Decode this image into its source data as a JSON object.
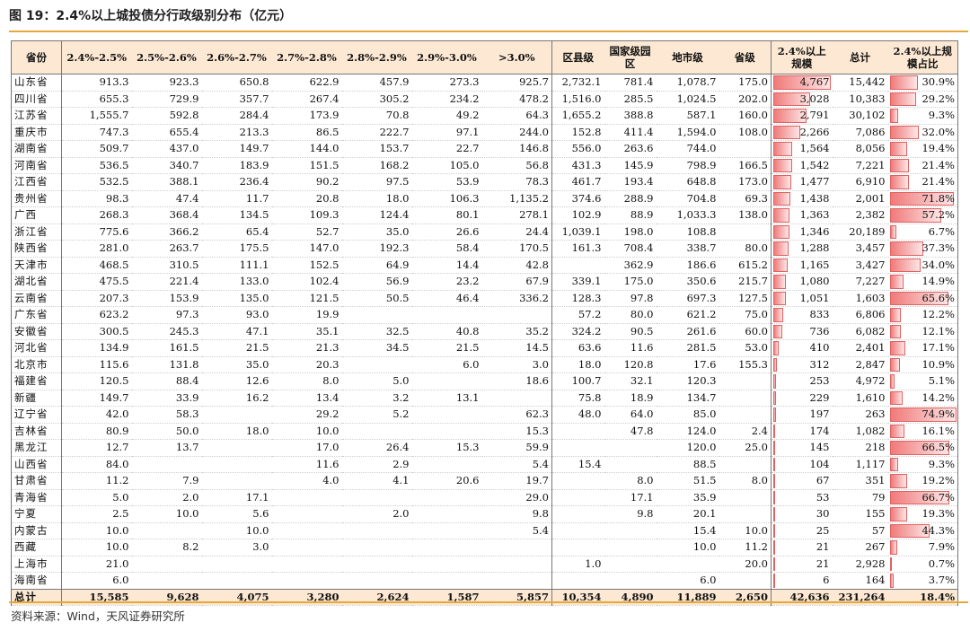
{
  "figure": {
    "title": "图 19：2.4%以上城投债分行政级别分布（亿元）",
    "source": "资料来源：Wind，天风证券研究所"
  },
  "headers": [
    "省份",
    "2.4%-2.5%",
    "2.5%-2.6%",
    "2.6%-2.7%",
    "2.7%-2.8%",
    "2.8%-2.9%",
    "2.9%-3.0%",
    ">3.0%",
    "区县级",
    "国家级园区",
    "地市级",
    "省级",
    "2.4%以上规模",
    "总计",
    "2.4%以上规模占比"
  ],
  "rows": [
    [
      "山东省",
      "913.3",
      "923.3",
      "650.8",
      "622.9",
      "457.9",
      "273.3",
      "925.7",
      "2,732.1",
      "781.4",
      "1,078.7",
      "175.0",
      "4,767",
      "15,442",
      "30.9%"
    ],
    [
      "四川省",
      "655.3",
      "729.9",
      "357.7",
      "267.4",
      "305.2",
      "234.2",
      "478.2",
      "1,516.0",
      "285.5",
      "1,024.5",
      "202.0",
      "3,028",
      "10,383",
      "29.2%"
    ],
    [
      "江苏省",
      "1,555.7",
      "592.8",
      "284.4",
      "173.9",
      "70.8",
      "49.2",
      "64.3",
      "1,655.2",
      "388.8",
      "587.1",
      "160.0",
      "2,791",
      "30,102",
      "9.3%"
    ],
    [
      "重庆市",
      "747.3",
      "655.4",
      "213.3",
      "86.5",
      "222.7",
      "97.1",
      "244.0",
      "152.8",
      "411.4",
      "1,594.0",
      "108.0",
      "2,266",
      "7,086",
      "32.0%"
    ],
    [
      "湖南省",
      "509.7",
      "437.0",
      "149.7",
      "144.0",
      "153.7",
      "22.7",
      "146.8",
      "556.0",
      "263.6",
      "744.0",
      "",
      "1,564",
      "8,056",
      "19.4%"
    ],
    [
      "河南省",
      "536.5",
      "340.7",
      "183.9",
      "151.5",
      "168.2",
      "105.0",
      "56.8",
      "431.3",
      "145.9",
      "798.9",
      "166.5",
      "1,542",
      "7,221",
      "21.4%"
    ],
    [
      "江西省",
      "532.5",
      "388.1",
      "236.4",
      "90.2",
      "97.5",
      "53.9",
      "78.3",
      "461.7",
      "193.4",
      "648.8",
      "173.0",
      "1,477",
      "6,910",
      "21.4%"
    ],
    [
      "贵州省",
      "98.3",
      "47.4",
      "11.7",
      "20.8",
      "18.0",
      "106.3",
      "1,135.2",
      "374.6",
      "288.9",
      "704.8",
      "69.3",
      "1,438",
      "2,001",
      "71.8%"
    ],
    [
      "广西",
      "268.3",
      "368.4",
      "134.5",
      "109.3",
      "124.4",
      "80.1",
      "278.1",
      "102.9",
      "88.9",
      "1,033.3",
      "138.0",
      "1,363",
      "2,382",
      "57.2%"
    ],
    [
      "浙江省",
      "775.6",
      "366.2",
      "65.4",
      "52.7",
      "35.0",
      "26.6",
      "24.4",
      "1,039.1",
      "198.0",
      "108.8",
      "",
      "1,346",
      "20,189",
      "6.7%"
    ],
    [
      "陕西省",
      "281.0",
      "263.7",
      "175.5",
      "147.0",
      "192.3",
      "58.4",
      "170.5",
      "161.3",
      "708.4",
      "338.7",
      "80.0",
      "1,288",
      "3,457",
      "37.3%"
    ],
    [
      "天津市",
      "468.5",
      "310.5",
      "111.1",
      "152.5",
      "64.9",
      "14.4",
      "42.8",
      "",
      "362.9",
      "186.6",
      "615.2",
      "1,165",
      "3,427",
      "34.0%"
    ],
    [
      "湖北省",
      "475.5",
      "221.4",
      "133.0",
      "102.4",
      "56.9",
      "23.2",
      "67.9",
      "339.1",
      "175.0",
      "350.6",
      "215.7",
      "1,080",
      "7,227",
      "14.9%"
    ],
    [
      "云南省",
      "207.3",
      "153.9",
      "135.0",
      "121.5",
      "50.5",
      "46.4",
      "336.2",
      "128.3",
      "97.8",
      "697.3",
      "127.5",
      "1,051",
      "1,603",
      "65.6%"
    ],
    [
      "广东省",
      "623.2",
      "97.3",
      "93.0",
      "19.9",
      "",
      "",
      "",
      "57.2",
      "80.0",
      "621.2",
      "75.0",
      "833",
      "6,806",
      "12.2%"
    ],
    [
      "安徽省",
      "300.5",
      "245.3",
      "47.1",
      "35.1",
      "32.5",
      "40.8",
      "35.2",
      "324.2",
      "90.5",
      "261.6",
      "60.0",
      "736",
      "6,082",
      "12.1%"
    ],
    [
      "河北省",
      "134.9",
      "161.5",
      "21.5",
      "21.3",
      "34.5",
      "21.5",
      "14.5",
      "63.6",
      "11.6",
      "281.5",
      "53.0",
      "410",
      "2,401",
      "17.1%"
    ],
    [
      "北京市",
      "115.6",
      "131.8",
      "35.0",
      "20.3",
      "",
      "6.0",
      "3.0",
      "18.0",
      "120.8",
      "17.6",
      "155.3",
      "312",
      "2,847",
      "10.9%"
    ],
    [
      "福建省",
      "120.5",
      "88.4",
      "12.6",
      "8.0",
      "5.0",
      "",
      "18.6",
      "100.7",
      "32.1",
      "120.3",
      "",
      "253",
      "4,972",
      "5.1%"
    ],
    [
      "新疆",
      "149.7",
      "33.9",
      "16.2",
      "13.4",
      "3.2",
      "13.1",
      "",
      "75.8",
      "18.9",
      "134.7",
      "",
      "229",
      "1,610",
      "14.2%"
    ],
    [
      "辽宁省",
      "42.0",
      "58.3",
      "",
      "29.2",
      "5.2",
      "",
      "62.3",
      "48.0",
      "64.0",
      "85.0",
      "",
      "197",
      "263",
      "74.9%"
    ],
    [
      "吉林省",
      "80.9",
      "50.0",
      "18.0",
      "10.0",
      "",
      "",
      "15.3",
      "",
      "47.8",
      "124.0",
      "2.4",
      "174",
      "1,082",
      "16.1%"
    ],
    [
      "黑龙江",
      "12.7",
      "13.7",
      "",
      "17.0",
      "26.4",
      "15.3",
      "59.9",
      "",
      "",
      "120.0",
      "25.0",
      "145",
      "218",
      "66.5%"
    ],
    [
      "山西省",
      "84.0",
      "",
      "",
      "11.6",
      "2.9",
      "",
      "5.4",
      "15.4",
      "",
      "88.5",
      "",
      "104",
      "1,117",
      "9.3%"
    ],
    [
      "甘肃省",
      "11.2",
      "7.9",
      "",
      "4.0",
      "4.1",
      "20.6",
      "19.7",
      "",
      "8.0",
      "51.5",
      "8.0",
      "67",
      "351",
      "19.2%"
    ],
    [
      "青海省",
      "5.0",
      "2.0",
      "17.1",
      "",
      "",
      "",
      "29.0",
      "",
      "17.1",
      "35.9",
      "",
      "53",
      "79",
      "66.7%"
    ],
    [
      "宁夏",
      "2.5",
      "10.0",
      "5.6",
      "",
      "2.0",
      "",
      "9.8",
      "",
      "9.8",
      "20.1",
      "",
      "30",
      "155",
      "19.3%"
    ],
    [
      "内蒙古",
      "10.0",
      "",
      "10.0",
      "",
      "",
      "",
      "5.4",
      "",
      "",
      "15.4",
      "10.0",
      "25",
      "57",
      "44.3%"
    ],
    [
      "西藏",
      "10.0",
      "8.2",
      "3.0",
      "",
      "",
      "",
      "",
      "",
      "",
      "10.0",
      "11.2",
      "21",
      "267",
      "7.9%"
    ],
    [
      "上海市",
      "21.0",
      "",
      "",
      "",
      "",
      "",
      "",
      "1.0",
      "",
      "",
      "20.0",
      "21",
      "2,928",
      "0.7%"
    ],
    [
      "海南省",
      "6.0",
      "",
      "",
      "",
      "",
      "",
      "",
      "",
      "",
      "6.0",
      "",
      "6",
      "164",
      "3.7%"
    ]
  ],
  "total_row": [
    "总计",
    "15,585",
    "9,628",
    "4,075",
    "3,280",
    "2,624",
    "1,587",
    "5,857",
    "10,354",
    "4,890",
    "11,889",
    "2,650",
    "42,636",
    "231,264",
    "18.4%"
  ],
  "scale_bars": {
    "scale_column_values": [
      4767,
      3028,
      2791,
      2266,
      1564,
      1542,
      1477,
      1438,
      1363,
      1346,
      1288,
      1165,
      1080,
      1051,
      833,
      736,
      410,
      312,
      253,
      229,
      197,
      174,
      145,
      104,
      67,
      53,
      30,
      25,
      21,
      21,
      6
    ],
    "scale_column_max": 4767,
    "share_column_values_pct": [
      30.9,
      29.2,
      9.3,
      32.0,
      19.4,
      21.4,
      21.4,
      71.8,
      57.2,
      6.7,
      37.3,
      34.0,
      14.9,
      65.6,
      12.2,
      12.1,
      17.1,
      10.9,
      5.1,
      14.2,
      74.9,
      16.1,
      66.5,
      9.3,
      19.2,
      66.7,
      19.3,
      44.3,
      7.9,
      0.7,
      3.7
    ],
    "share_column_max_pct": 74.9,
    "bar_color": "#f07a7a"
  }
}
